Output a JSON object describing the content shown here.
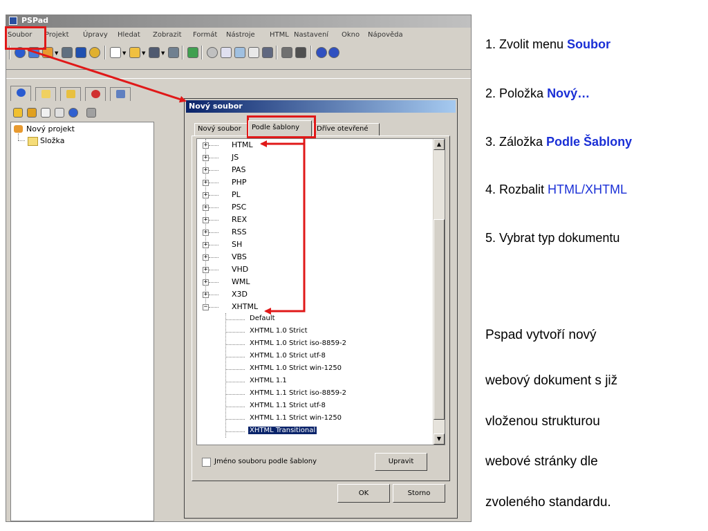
{
  "app": {
    "title": "PSPad"
  },
  "menubar": [
    "Soubor",
    "Projekt",
    "Úpravy",
    "Hledat",
    "Zobrazit",
    "Formát",
    "Nástroje",
    "HTML",
    "Nastavení",
    "Okno",
    "Nápověda"
  ],
  "project_tree": {
    "project": "Nový projekt",
    "folder": "Složka"
  },
  "dialog": {
    "title": "Nový soubor",
    "tabs": [
      "Nový soubor",
      "Podle šablony",
      "Dříve otevřené"
    ],
    "active_tab": "Podle šablony",
    "tree_top": [
      "HTML",
      "JS",
      "PAS",
      "PHP",
      "PL",
      "PSC",
      "REX",
      "RSS",
      "SH",
      "VBS",
      "VHD",
      "WML",
      "X3D",
      "XHTML"
    ],
    "xhtml_children": [
      "Default",
      "XHTML 1.0 Strict",
      "XHTML 1.0 Strict iso-8859-2",
      "XHTML 1.0 Strict utf-8",
      "XHTML 1.0 Strict win-1250",
      "XHTML 1.1",
      "XHTML 1.1 Strict iso-8859-2",
      "XHTML 1.1 Strict utf-8",
      "XHTML 1.1 Strict win-1250",
      "XHTML Transitional"
    ],
    "selected_item": "XHTML Transitional",
    "checkbox_label": "Jméno souboru podle šablony",
    "checkbox_checked": false,
    "edit_button": "Upravit",
    "ok_button": "OK",
    "cancel_button": "Storno"
  },
  "instructions": {
    "step1": {
      "prefix": "1. Zvolit menu ",
      "highlight": "Soubor"
    },
    "step2": {
      "prefix": "2. Položka ",
      "highlight": "Nový…"
    },
    "step3": {
      "prefix": "3. Záložka ",
      "highlight": "Podle Šablony"
    },
    "step4": {
      "prefix": "4. Rozbalit ",
      "highlight": "HTML/XHTML"
    },
    "step5": {
      "prefix": "5. Vybrat typ dokumentu"
    },
    "paragraph": [
      "Pspad vytvoří nový",
      "webový dokument s již",
      "vloženou strukturou",
      "webové stránky dle",
      "zvoleného standardu."
    ]
  },
  "colors": {
    "annotation_red": "#e01818",
    "highlight_blue": "#1a2fd6",
    "selection": "#0a246a"
  }
}
